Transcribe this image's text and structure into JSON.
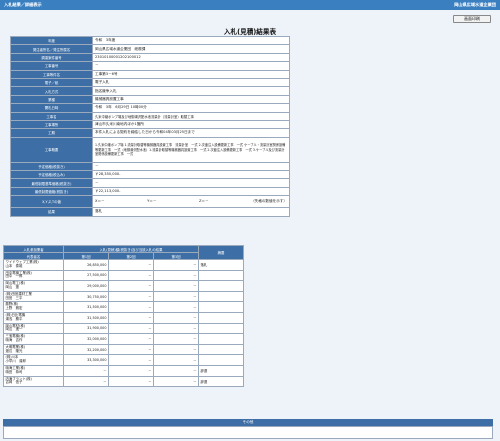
{
  "header": {
    "left_title": "入札結果／詳細表示",
    "right_title": "岡山県広域水道企業団"
  },
  "toolbar": {
    "print_label": "画面印刷"
  },
  "page_title": "入札(見積)結果表",
  "details": [
    {
      "label": "年度",
      "value": "令和　3年度"
    },
    {
      "label": "発注者所名／発注所属名",
      "value": "岡山県広域水道企業団　総務課"
    },
    {
      "label": "調達案件番号",
      "value": "23010100001202100012"
    },
    {
      "label": "工事番号",
      "value": "－"
    },
    {
      "label": "工事等件名",
      "value": "工事第3－6号"
    },
    {
      "label": "電子／紙",
      "value": "電子入札"
    },
    {
      "label": "入札方式",
      "value": "指名競争入札"
    },
    {
      "label": "業種",
      "value": "機械器具設置工事"
    },
    {
      "label": "開札日時",
      "value": "令和　3年　6月29日 10時00分"
    },
    {
      "label": "工事名",
      "value": "久米中継ポンプ場及び地御湯沢配水池流量計（流量計室）取替工事"
    },
    {
      "label": "工事場所",
      "value": "津山市久米川南地内ほか1箇所"
    },
    {
      "label": "工期",
      "value": "本件入札による契約を締結した日から令和04年03月25日まで"
    },
    {
      "label": "工事概要",
      "value": "1.久米中継ポンプ場 1.流量計取替等機械器具設置工事　流量計室　一式 2.次亜注入設備更新工事　一式 ケーブル・流量計室関係設備等更新工事　一式（地御湯沢配水池）1.流量計取替等機械器具設置工事　一式 2.次亜注入設備更新工事　一式 3.ケーブル及び流量計室関係設備更新工事　一式"
    },
    {
      "label": "予定価格(税抜き)",
      "value": "－"
    },
    {
      "label": "予定価格(税込み)",
      "value": "￥28,350,000-"
    },
    {
      "label": "最低制限基準価格(税抜き)",
      "value": "－"
    },
    {
      "label": "最低制限価格(税抜き)",
      "value": "￥22,113,000-"
    },
    {
      "label": "X,Y,Z,Tの値",
      "x": "X＝－",
      "y": "Y＝－",
      "z": "Z＝－",
      "t": "（失格の数値を示す）"
    },
    {
      "label": "結果",
      "value": "落札"
    }
  ],
  "bids": {
    "col_bidder": "入札参加業者",
    "col_amount_group": "入札(見積)額(税抜き)及び当該入札の結果",
    "col_name": "代表者名",
    "col_round1": "第1回",
    "col_round2": "第2回",
    "col_round3": "第3回",
    "col_note": "摘要",
    "rows": [
      {
        "company": "ワイドウェブ工業(株)",
        "person": "山本　泰雄",
        "r1": "26,850,000",
        "r2": "－",
        "r3": "－",
        "note": "落札"
      },
      {
        "company": "田中電機工業(株)",
        "person": "田中　一郎",
        "r1": "27,500,000",
        "r2": "－",
        "r3": "－",
        "note": ""
      },
      {
        "company": "岡山電工(株)",
        "person": "岡山　蓮",
        "r1": "29,000,000",
        "r2": "－",
        "r3": "－",
        "note": ""
      },
      {
        "company": "(株)田宮建材工業",
        "person": "田宮　三平",
        "r1": "30,750,000",
        "r2": "－",
        "r3": "－",
        "note": ""
      },
      {
        "company": "藤野(株)",
        "person": "上野　雅宏",
        "r1": "31,500,000",
        "r2": "－",
        "r3": "－",
        "note": ""
      },
      {
        "company": "(株)日比電機",
        "person": "湯浅　勝平",
        "r1": "31,500,000",
        "r2": "－",
        "r3": "－",
        "note": ""
      },
      {
        "company": "岡山電材(株)",
        "person": "岡山　進一",
        "r1": "31,900,000",
        "r2": "－",
        "r3": "－",
        "note": ""
      },
      {
        "company": "三宝電機(株)",
        "person": "鳴海　吉作",
        "r1": "32,000,000",
        "r2": "－",
        "r3": "－",
        "note": ""
      },
      {
        "company": "大明電業(株)",
        "person": "渡辺　隆光",
        "r1": "32,200,000",
        "r2": "－",
        "r3": "－",
        "note": ""
      },
      {
        "company": "(株)川本",
        "person": "小早川　達郎",
        "r1": "33,300,000",
        "r2": "－",
        "r3": "－",
        "note": ""
      },
      {
        "company": "鳴海工業(株)",
        "person": "鳴田　恭司",
        "r1": "－",
        "r2": "－",
        "r3": "－",
        "note": "辞退"
      },
      {
        "company": "内海ブラント(株)",
        "person": "吉岡　信子",
        "r1": "－",
        "r2": "－",
        "r3": "－",
        "note": "辞退"
      }
    ]
  },
  "other": {
    "label": "その他",
    "value": ""
  }
}
